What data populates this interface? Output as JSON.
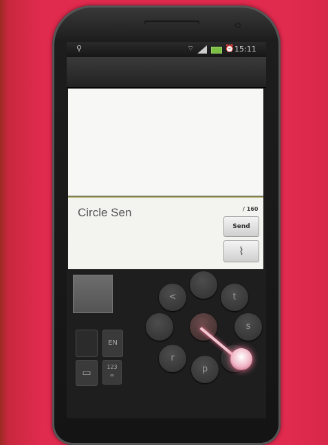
{
  "status_bar": {
    "time": "15:11",
    "left_icon": "usb-icon",
    "wifi_icon": "wifi-icon",
    "signal_icon": "signal-icon",
    "battery_icon": "battery-icon",
    "alarm_icon": "alarm-icon"
  },
  "compose": {
    "text": "Circle Sen",
    "counter": "/ 160",
    "send_label": "Send",
    "attach_icon": "paperclip-icon"
  },
  "keyboard": {
    "lang_key": "EN",
    "num_key_top": "123",
    "num_key_bottom": "∞",
    "screen_key": "▭",
    "circle_keys": {
      "top": "",
      "top_left": "<",
      "top_right": "t",
      "left": "",
      "center": "",
      "right": "s",
      "bottom_left": "r",
      "bottom": "p",
      "bottom_right": ""
    }
  },
  "colors": {
    "background": "#e02a4e",
    "trace": "#f1c6d0",
    "battery": "#7bc043"
  }
}
